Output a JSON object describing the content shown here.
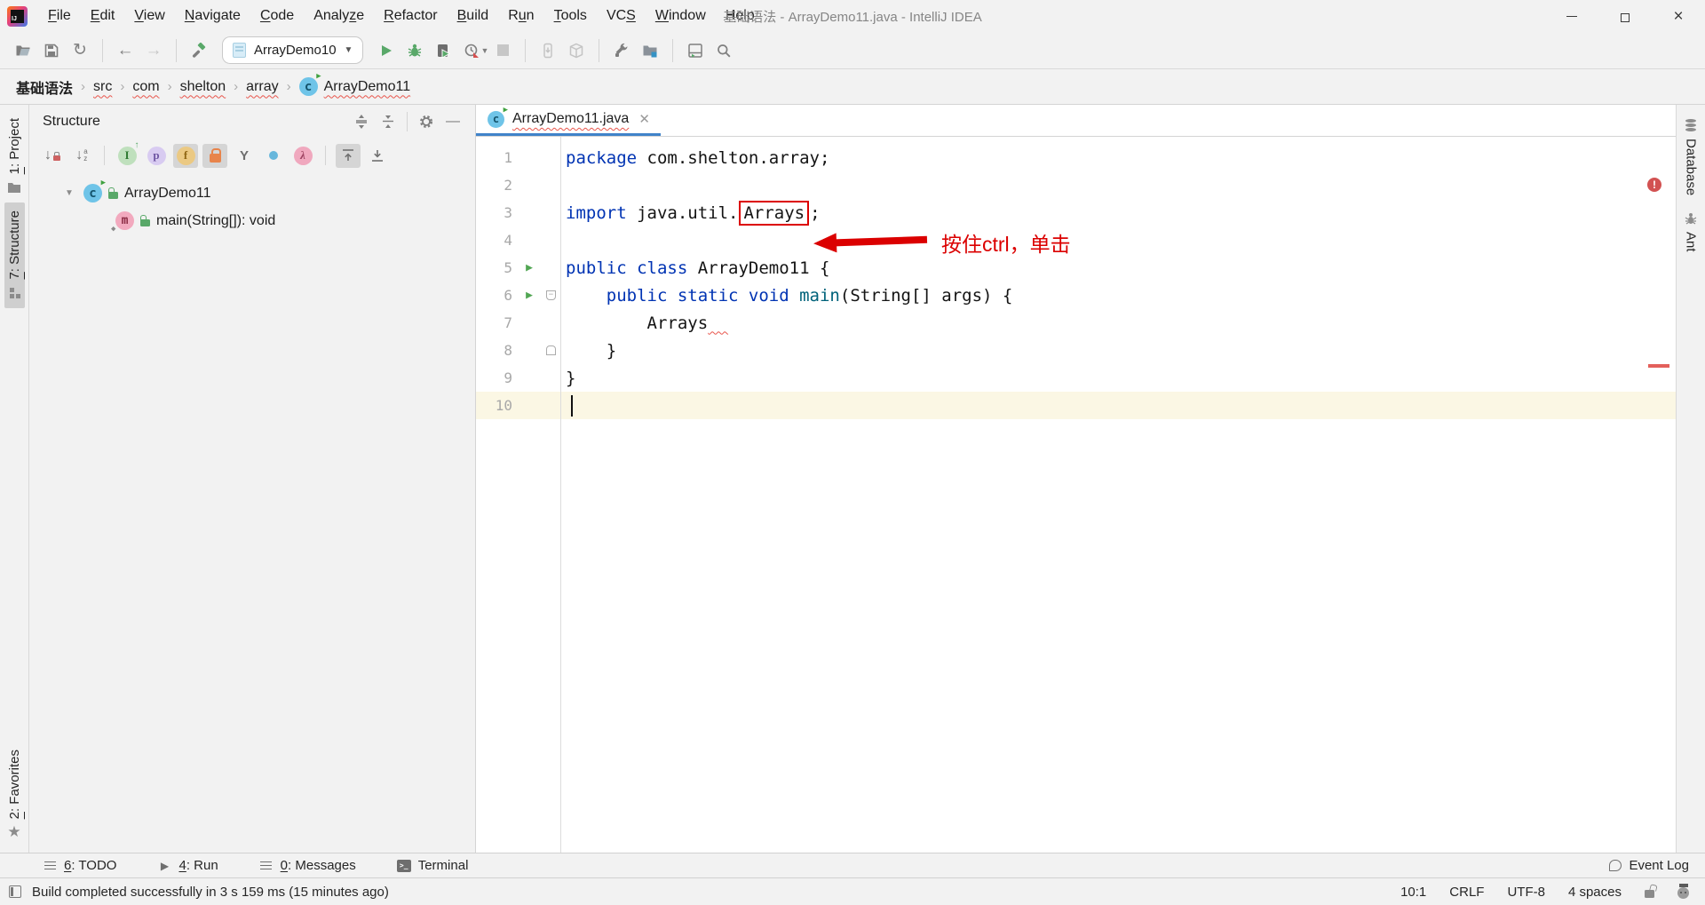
{
  "window": {
    "title": "基础语法 - ArrayDemo11.java - IntelliJ IDEA"
  },
  "menubar": {
    "items": [
      {
        "label": "File",
        "u": 0
      },
      {
        "label": "Edit",
        "u": 0
      },
      {
        "label": "View",
        "u": 0
      },
      {
        "label": "Navigate",
        "u": 0
      },
      {
        "label": "Code",
        "u": 0
      },
      {
        "label": "Analyze",
        "u": 5
      },
      {
        "label": "Refactor",
        "u": 0
      },
      {
        "label": "Build",
        "u": 0
      },
      {
        "label": "Run",
        "u": 1
      },
      {
        "label": "Tools",
        "u": 0
      },
      {
        "label": "VCS",
        "u": 2
      },
      {
        "label": "Window",
        "u": 0
      },
      {
        "label": "Help",
        "u": 0
      }
    ]
  },
  "toolbar": {
    "run_config": "ArrayDemo10",
    "icons": [
      "open-project",
      "save-all",
      "synchronize",
      "back",
      "forward",
      "build-hammer",
      "run",
      "debug",
      "run-with-coverage",
      "profiler",
      "stop",
      "update-project",
      "commit-package",
      "settings-wrench",
      "project-structure",
      "tool-windows",
      "search-everywhere"
    ]
  },
  "breadcrumbs": {
    "project": "基础语法",
    "path": [
      "src",
      "com",
      "shelton",
      "array"
    ],
    "class": "ArrayDemo11"
  },
  "left_strip": {
    "tabs": [
      {
        "label": "1: Project",
        "u": 0,
        "icon": "project-folder",
        "selected": false
      },
      {
        "label": "7: Structure",
        "u": 0,
        "icon": "structure-squares",
        "selected": true
      },
      {
        "label": "2: Favorites",
        "u": 0,
        "icon": "star",
        "selected": false,
        "bottom": true
      }
    ]
  },
  "right_strip": {
    "tabs": [
      {
        "label": "Database",
        "icon": "database"
      },
      {
        "label": "Ant",
        "icon": "ant"
      }
    ]
  },
  "structure_panel": {
    "title": "Structure",
    "tree": [
      {
        "label": "ArrayDemo11",
        "icon": "class",
        "lock": true,
        "expanded": true,
        "level": 0
      },
      {
        "label": "main(String[]): void",
        "icon": "method",
        "lock": true,
        "level": 1
      }
    ]
  },
  "editor": {
    "tab": {
      "name": "ArrayDemo11.java"
    },
    "lines": [
      {
        "n": "1",
        "tokens": [
          {
            "t": "package ",
            "c": "kw"
          },
          {
            "t": "com.shelton.array;",
            "c": "pl"
          }
        ]
      },
      {
        "n": "2",
        "tokens": []
      },
      {
        "n": "3",
        "tokens": [
          {
            "t": "import ",
            "c": "kw"
          },
          {
            "t": "java.util.",
            "c": "pl"
          },
          {
            "t": "Arrays",
            "c": "pl",
            "box": true
          },
          {
            "t": ";",
            "c": "pl"
          }
        ]
      },
      {
        "n": "4",
        "tokens": []
      },
      {
        "n": "5",
        "run": true,
        "tokens": [
          {
            "t": "public class ",
            "c": "kw"
          },
          {
            "t": "ArrayDemo11 {",
            "c": "pl"
          }
        ]
      },
      {
        "n": "6",
        "run": true,
        "fold": "start",
        "tokens": [
          {
            "t": "    ",
            "c": "pl"
          },
          {
            "t": "public static void ",
            "c": "kw"
          },
          {
            "t": "main",
            "c": "fn"
          },
          {
            "t": "(String[] args) {",
            "c": "pl"
          }
        ]
      },
      {
        "n": "7",
        "tokens": [
          {
            "t": "        Arrays",
            "c": "pl"
          },
          {
            "t": "  ",
            "c": "squig"
          }
        ]
      },
      {
        "n": "8",
        "fold": "end",
        "tokens": [
          {
            "t": "    }",
            "c": "pl"
          }
        ]
      },
      {
        "n": "9",
        "tokens": [
          {
            "t": "}",
            "c": "pl"
          }
        ]
      },
      {
        "n": "10",
        "current": true,
        "caret": true,
        "tokens": []
      }
    ]
  },
  "annotation": {
    "label": "按住ctrl，单击",
    "target": "Arrays"
  },
  "bottom_bar": {
    "left": [
      {
        "label": "6: TODO",
        "u": 0,
        "icon": "todo"
      },
      {
        "label": "4: Run",
        "u": 0,
        "icon": "run"
      },
      {
        "label": "0: Messages",
        "u": 0,
        "icon": "messages"
      },
      {
        "label": "Terminal",
        "icon": "terminal"
      }
    ],
    "right": [
      {
        "label": "Event Log",
        "icon": "event-log"
      }
    ]
  },
  "status_bar": {
    "message": "Build completed successfully in 3 s 159 ms (15 minutes ago)",
    "caret_position": "10:1",
    "line_ending": "CRLF",
    "encoding": "UTF-8",
    "indent": "4 spaces"
  },
  "colors": {
    "keyword": "#0033B3",
    "method_name": "#00627A",
    "annotation_red": "#DB0000",
    "run_green": "#59A869",
    "tab_underline": "#4083C9",
    "current_line_bg": "#FBF7E4",
    "error_stripe": "#E3605B"
  }
}
